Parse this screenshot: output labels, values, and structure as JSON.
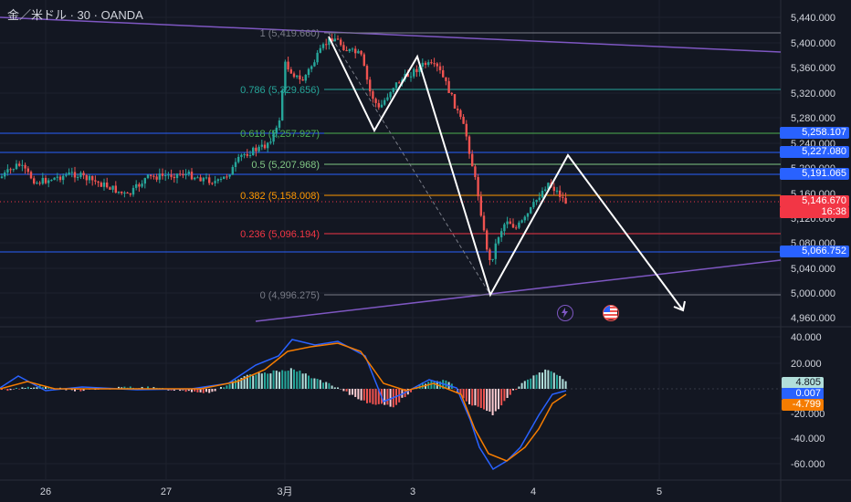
{
  "header": {
    "title": "金／米ドル · 30 · OANDA"
  },
  "price_axis": {
    "ticks": [
      "5,440.000",
      "5,400.000",
      "5,360.000",
      "5,320.000",
      "5,280.000",
      "5,240.000",
      "5,200.000",
      "5,160.000",
      "5,120.000",
      "5,080.000",
      "5,040.000",
      "5,000.000",
      "4,960.000"
    ]
  },
  "osc_axis": {
    "ticks": [
      "40.000",
      "20.000",
      "-20.000",
      "-40.000",
      "-60.000"
    ]
  },
  "time_axis": {
    "labels": [
      "26",
      "27",
      "3月",
      "3",
      "4",
      "5"
    ]
  },
  "fib_levels": [
    {
      "label": "1 (5,419.660)",
      "color": "#787b86"
    },
    {
      "label": "0.786 (5,329.656)",
      "color": "#26a69a"
    },
    {
      "label": "0.618 (5,257.927)",
      "color": "#4caf50"
    },
    {
      "label": "0.5 (5,207.968)",
      "color": "#81c784"
    },
    {
      "label": "0.382 (5,158.008)",
      "color": "#ff9800"
    },
    {
      "label": "0.236 (5,096.194)",
      "color": "#f23645"
    },
    {
      "label": "0 (4,996.275)",
      "color": "#787b86"
    }
  ],
  "price_tags": [
    {
      "label": "5,258.107",
      "color": "#2962ff"
    },
    {
      "label": "5,227.080",
      "color": "#2962ff"
    },
    {
      "label": "5,191.065",
      "color": "#2962ff"
    },
    {
      "label": "5,146.670",
      "color": "#f23645"
    },
    {
      "label": "16:38",
      "color": "#f23645"
    },
    {
      "label": "5,066.752",
      "color": "#2962ff"
    }
  ],
  "osc_tags": [
    {
      "label": "4.805",
      "color": "#b2dfdb"
    },
    {
      "label": "0.007",
      "color": "#2962ff"
    },
    {
      "label": "-4.799",
      "color": "#f57c00"
    }
  ],
  "icons": {
    "flash": "lightning-icon",
    "flag": "us-flag-icon"
  },
  "colors": {
    "up": "#26a69a",
    "down": "#ef5350",
    "trend": "#7e57c2",
    "hline": "#2962ff",
    "zigzag": "#ffffff"
  }
}
